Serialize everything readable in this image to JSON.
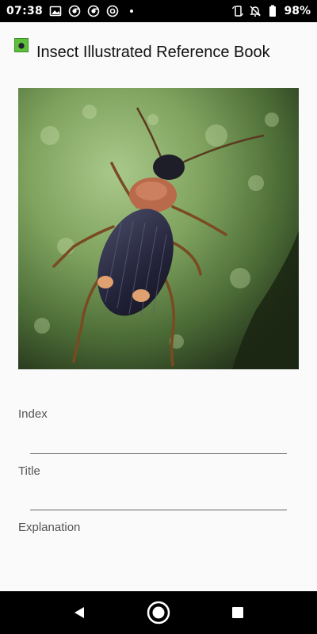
{
  "status_bar": {
    "time": "07:38",
    "battery": "98%"
  },
  "app": {
    "title": "Insect Illustrated Reference Book"
  },
  "form": {
    "index_label": "Index",
    "title_label": "Title",
    "explanation_label": "Explanation",
    "index_value": "",
    "title_value": ""
  },
  "icons": {
    "status_left": [
      "gallery-icon",
      "chrome-icon",
      "chrome-icon",
      "at-sign-icon",
      "dot-icon"
    ],
    "status_right": [
      "rotate-icon",
      "bell-off-icon",
      "battery-icon"
    ],
    "nav": [
      "back-icon",
      "home-icon",
      "recents-icon"
    ]
  }
}
